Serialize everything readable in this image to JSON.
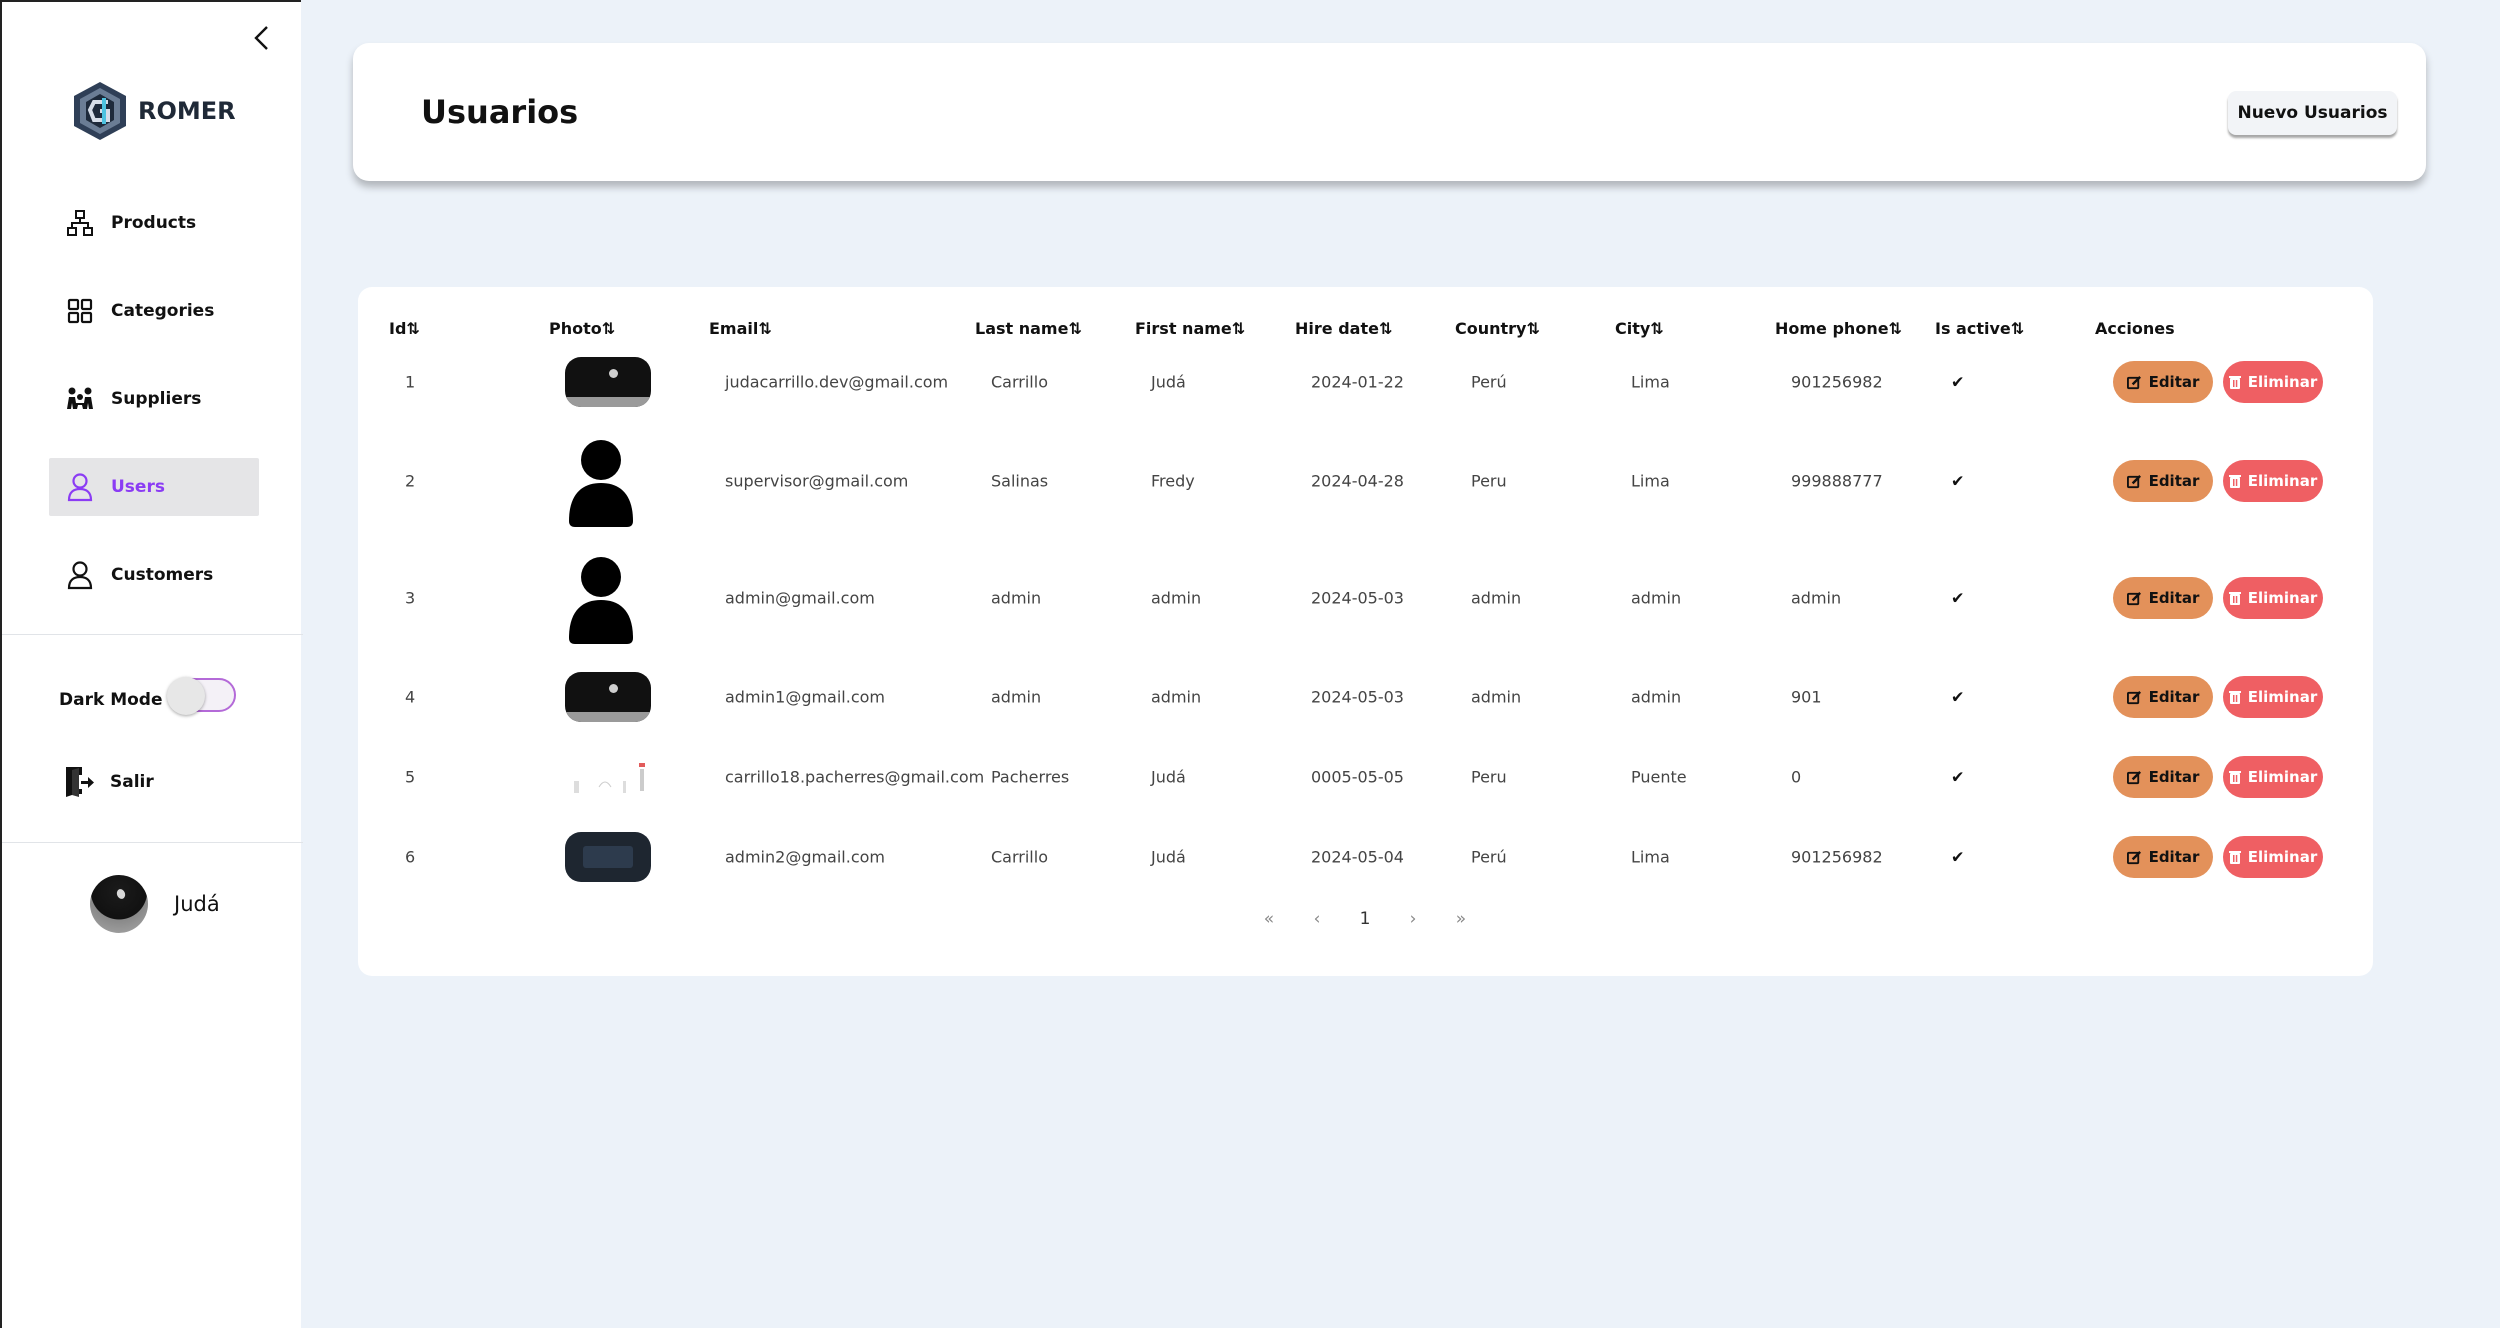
{
  "sidebar": {
    "brand": "ROMER",
    "items": [
      {
        "label": "Products",
        "icon": "sitemap-icon"
      },
      {
        "label": "Categories",
        "icon": "grid-icon"
      },
      {
        "label": "Suppliers",
        "icon": "people-icon"
      },
      {
        "label": "Users",
        "icon": "user-icon",
        "active": true
      },
      {
        "label": "Customers",
        "icon": "user-icon"
      }
    ],
    "dark_mode_label": "Dark Mode",
    "dark_mode_on": false,
    "logout_label": "Salir",
    "user_name": "Judá"
  },
  "header": {
    "title": "Usuarios",
    "new_button": "Nuevo Usuarios"
  },
  "table": {
    "columns": [
      "Id⇅",
      "Photo⇅",
      "Email⇅",
      "Last name⇅",
      "First name⇅",
      "Hire date⇅",
      "Country⇅",
      "City⇅",
      "Home phone⇅",
      "Is active⇅",
      "Acciones"
    ],
    "rows": [
      {
        "id": "1",
        "photo": "dark",
        "email": "judacarrillo.dev@gmail.com",
        "last_name": "Carrillo",
        "first_name": "Judá",
        "hire_date": "2024-01-22",
        "country": "Perú",
        "city": "Lima",
        "home_phone": "901256982",
        "active": "✔"
      },
      {
        "id": "2",
        "photo": "person",
        "email": "supervisor@gmail.com",
        "last_name": "Salinas",
        "first_name": "Fredy",
        "hire_date": "2024-04-28",
        "country": "Peru",
        "city": "Lima",
        "home_phone": "999888777",
        "active": "✔"
      },
      {
        "id": "3",
        "photo": "person",
        "email": "admin@gmail.com",
        "last_name": "admin",
        "first_name": "admin",
        "hire_date": "2024-05-03",
        "country": "admin",
        "city": "admin",
        "home_phone": "admin",
        "active": "✔"
      },
      {
        "id": "4",
        "photo": "dark",
        "email": "admin1@gmail.com",
        "last_name": "admin",
        "first_name": "admin",
        "hire_date": "2024-05-03",
        "country": "admin",
        "city": "admin",
        "home_phone": "901",
        "active": "✔"
      },
      {
        "id": "5",
        "photo": "sketch",
        "email": "carrillo18.pacherres@gmail.com",
        "last_name": "Pacherres",
        "first_name": "Judá",
        "hire_date": "0005-05-05",
        "country": "Peru",
        "city": "Puente",
        "home_phone": "0",
        "active": "✔"
      },
      {
        "id": "6",
        "photo": "screen",
        "email": "admin2@gmail.com",
        "last_name": "Carrillo",
        "first_name": "Judá",
        "hire_date": "2024-05-04",
        "country": "Perú",
        "city": "Lima",
        "home_phone": "901256982",
        "active": "✔"
      }
    ],
    "edit_label": "Editar",
    "delete_label": "Eliminar"
  },
  "pagination": {
    "first": "«",
    "prev": "‹",
    "current": "1",
    "next": "›",
    "last": "»"
  },
  "colors": {
    "background": "#ecf2f9",
    "accent": "#8b3cf4",
    "edit_button": "#e3915a",
    "delete_button": "#ef5f63"
  }
}
